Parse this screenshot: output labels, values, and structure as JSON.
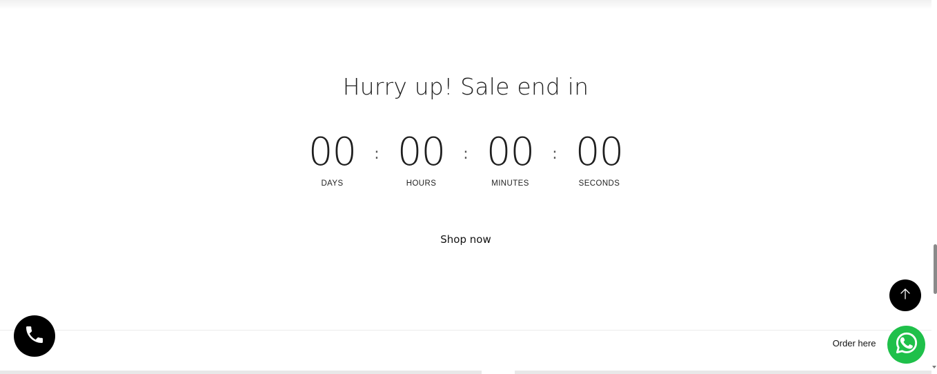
{
  "sale": {
    "title": "Hurry up! Sale end in"
  },
  "countdown": {
    "separator": ":",
    "units": [
      {
        "value": "00",
        "label": "DAYS"
      },
      {
        "value": "00",
        "label": "HOURS"
      },
      {
        "value": "00",
        "label": "MINUTES"
      },
      {
        "value": "00",
        "label": "SECONDS"
      }
    ]
  },
  "cta": {
    "shop_now": "Shop now"
  },
  "floating": {
    "call_icon": "phone-icon",
    "back_to_top_icon": "arrow-up-icon",
    "order_label": "Order here",
    "whatsapp_icon": "whatsapp-icon",
    "whatsapp_color": "#1fc04a",
    "button_color": "#000000"
  }
}
